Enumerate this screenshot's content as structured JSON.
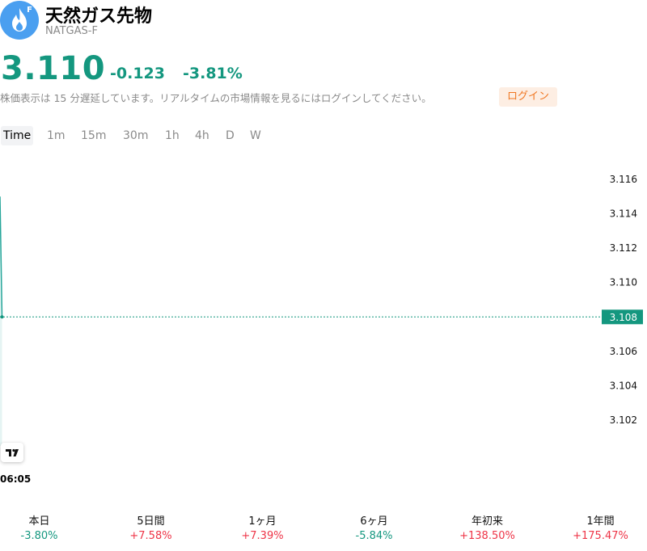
{
  "header": {
    "title": "天然ガス先物",
    "ticker": "NATGAS-F",
    "logo_badge": "F",
    "logo_icon": "flame-icon",
    "logo_color": "#4a9ff0"
  },
  "quote": {
    "price": "3.110",
    "change": "-0.123",
    "change_pct": "-3.81%",
    "color": "#14977f"
  },
  "notice": {
    "text": "株価表示は 15 分遅延しています。リアルタイムの市場情報を見るにはログインしてください。",
    "login_label": "ログイン"
  },
  "timeframes": [
    "Time",
    "1m",
    "15m",
    "30m",
    "1h",
    "4h",
    "D",
    "W"
  ],
  "active_timeframe": "Time",
  "chart_data": {
    "type": "line",
    "x": [
      "06:05",
      "06:05"
    ],
    "y": [
      3.115,
      3.108
    ],
    "ylim": [
      3.1005,
      3.1175
    ],
    "yticks": [
      "3.116",
      "3.114",
      "3.112",
      "3.110",
      "3.108",
      "3.106",
      "3.104",
      "3.102"
    ],
    "last_value": "3.108",
    "xtick_label": "06:05",
    "line_color": "#26a69a",
    "grid": false
  },
  "performance": [
    {
      "label": "本日",
      "value": "-3.80%",
      "dir": "neg"
    },
    {
      "label": "5日間",
      "value": "+7.58%",
      "dir": "pos"
    },
    {
      "label": "1ヶ月",
      "value": "+7.39%",
      "dir": "pos"
    },
    {
      "label": "6ヶ月",
      "value": "-5.84%",
      "dir": "neg"
    },
    {
      "label": "年初来",
      "value": "+138.50%",
      "dir": "pos"
    },
    {
      "label": "1年間",
      "value": "+175.47%",
      "dir": "pos"
    }
  ]
}
